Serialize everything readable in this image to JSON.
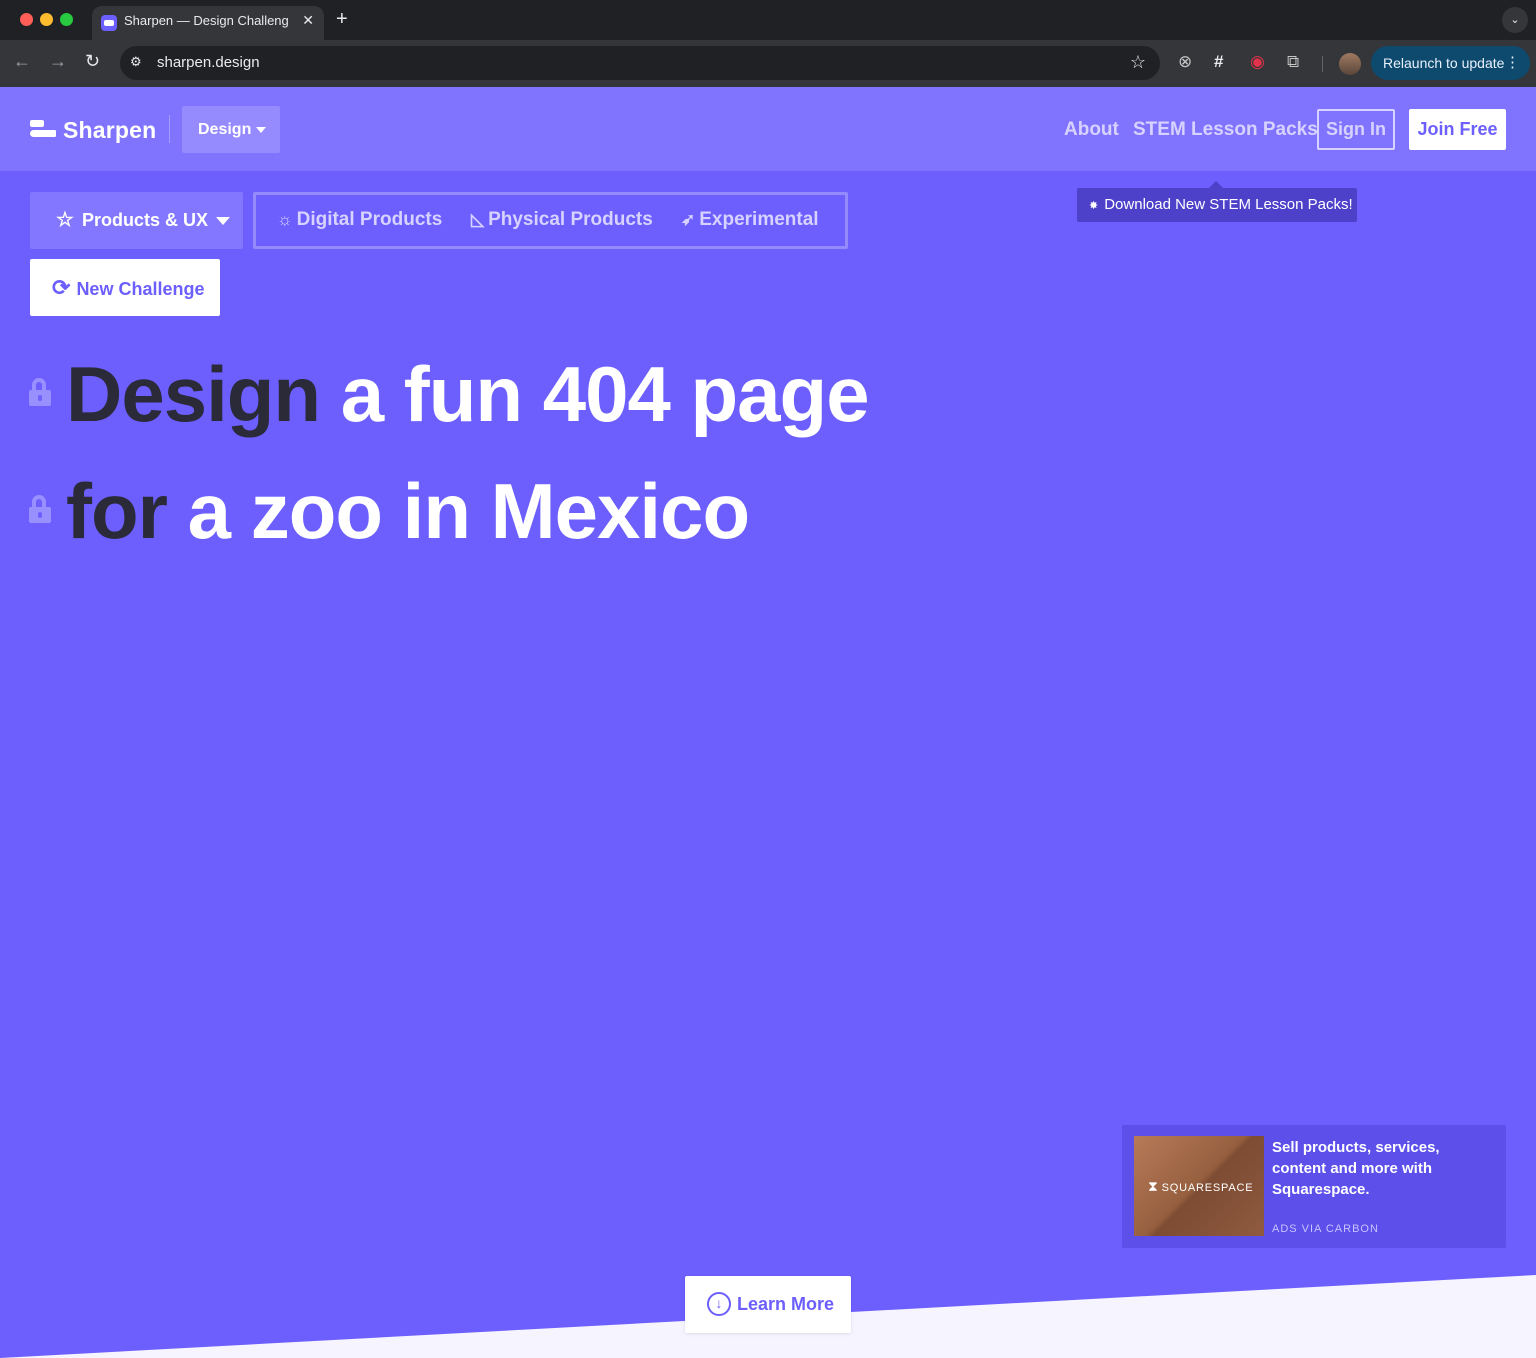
{
  "browser": {
    "tab_title": "Sharpen — Design Challenge",
    "tab_close": "✕",
    "new_tab": "+",
    "url": "sharpen.design",
    "relaunch_label": "Relaunch to update"
  },
  "header": {
    "logo_text": "Sharpen",
    "design_dropdown": "Design",
    "nav": {
      "about": "About",
      "stem": "STEM Lesson Packs"
    },
    "sign_in": "Sign In",
    "join_free": "Join Free"
  },
  "tooltip": {
    "text": "Download New STEM Lesson Packs!"
  },
  "categories": {
    "selected": "Products & UX",
    "items": [
      "Digital Products",
      "Physical Products",
      "Experimental"
    ]
  },
  "new_challenge_label": "New Challenge",
  "headline": {
    "line1_dark": "Design",
    "line1_light": "a fun 404 page",
    "line2_dark": "for",
    "line2_light": "a zoo in Mexico"
  },
  "ad": {
    "brand": "SQUARESPACE",
    "text": "Sell products, services, content and more with Squarespace.",
    "via": "ADS VIA CARBON"
  },
  "learn_more_label": "Learn More",
  "colors": {
    "brand_purple": "#6c5ffd",
    "header_purple": "#8074ff",
    "headline_dark": "#2a2a38",
    "tooltip_bg": "#4d41c9"
  },
  "icons": {
    "star": "star-icon",
    "bulb": "lightbulb-icon",
    "triangle": "set-square-icon",
    "rocket": "rocket-icon",
    "refresh": "refresh-icon",
    "lock": "unlocked-padlock-icon",
    "download": "arrow-down-circle-icon"
  }
}
